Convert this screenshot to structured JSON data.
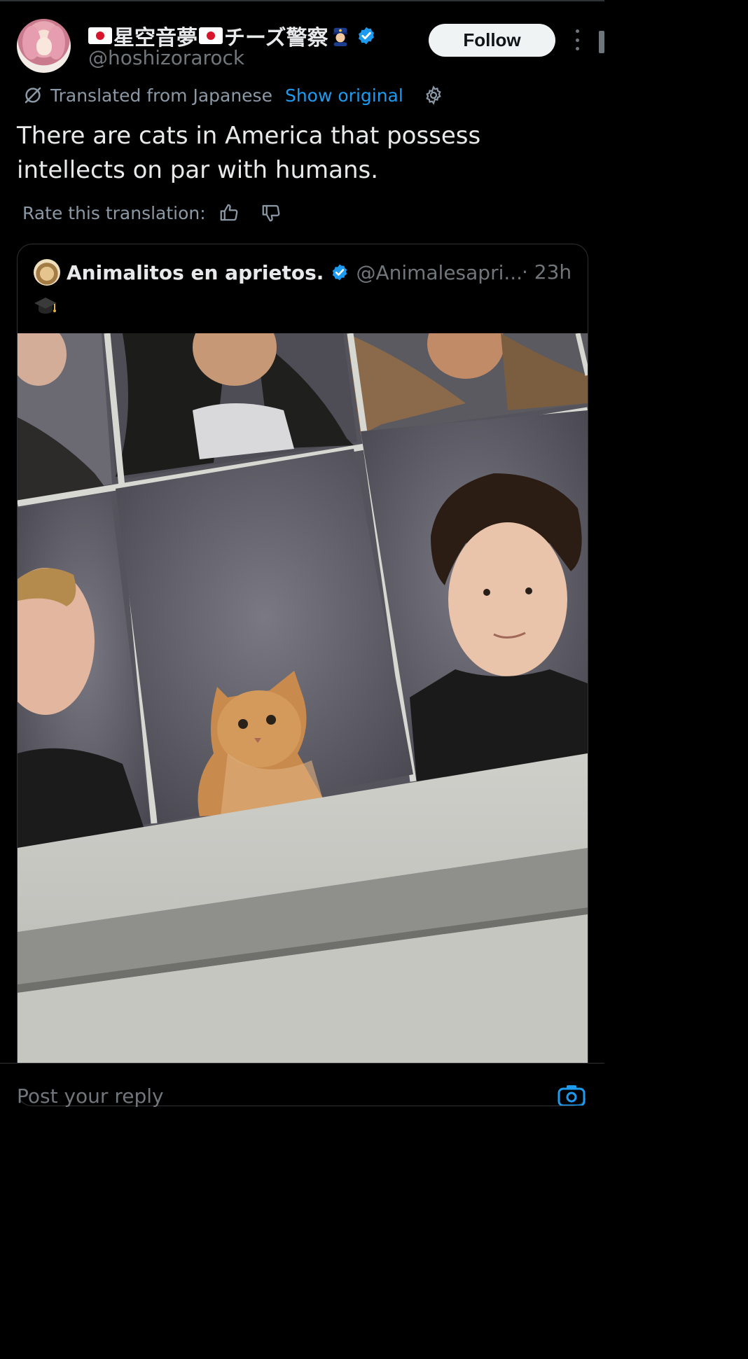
{
  "header": {
    "display_name_middle": "星空音夢",
    "display_name_suffix": "チーズ警察",
    "handle": "@hoshizorarock",
    "follow_label": "Follow"
  },
  "translation": {
    "label": "Translated from Japanese",
    "show_original": "Show original"
  },
  "tweet": {
    "text": "There are cats in America that possess intellects on par with humans."
  },
  "rate": {
    "label": "Rate this translation:"
  },
  "quote": {
    "name": "Animalitos en aprietos.",
    "handle": "@Animalesapri...",
    "time": "· 23h"
  },
  "reply": {
    "placeholder": "Post your reply"
  },
  "colors": {
    "accent": "#1d9bf0",
    "background": "#000000",
    "muted": "#71767b"
  }
}
